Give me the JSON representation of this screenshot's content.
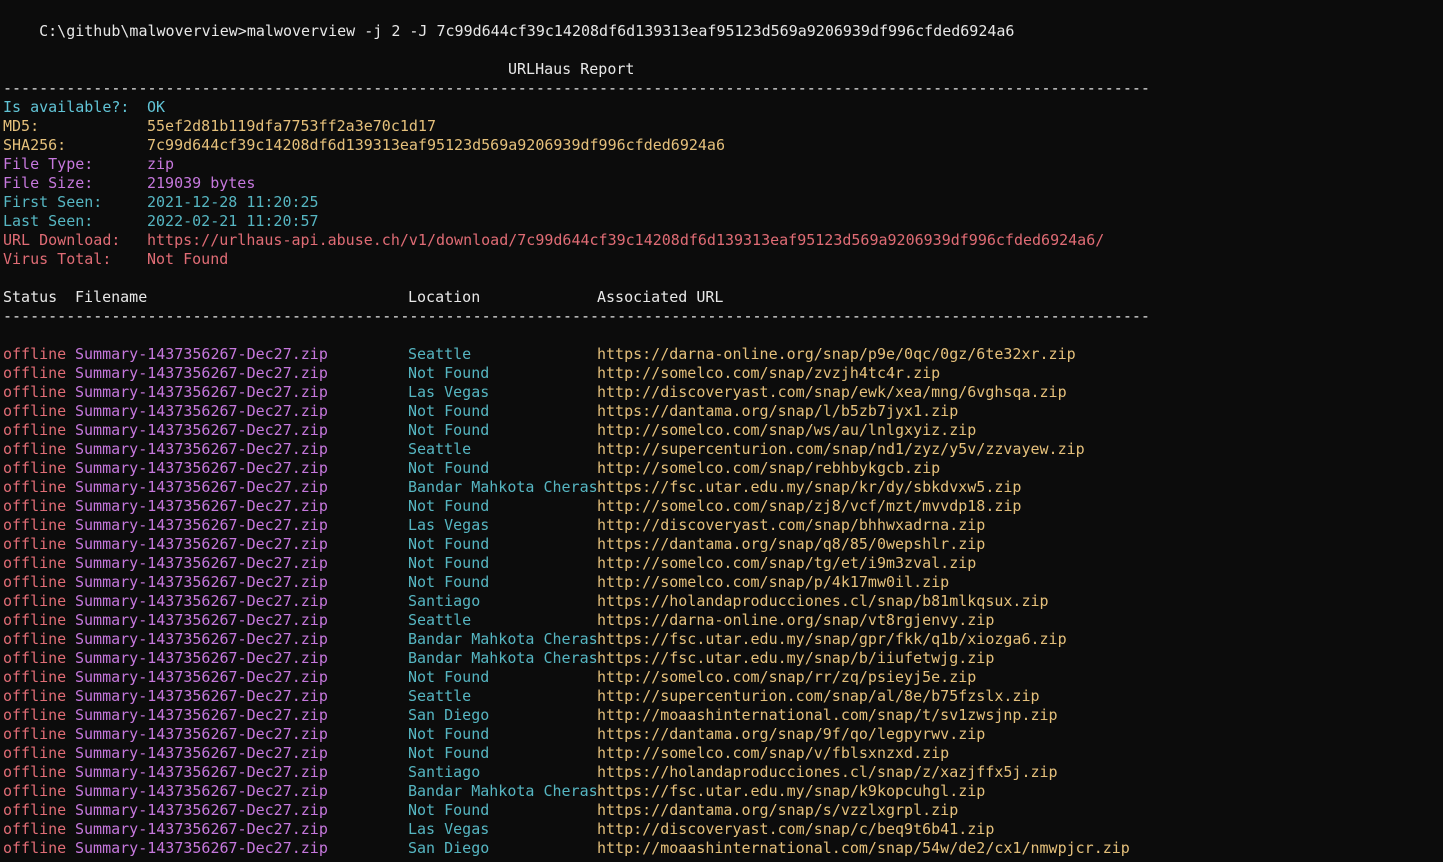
{
  "prompt": {
    "path": "C:\\github\\malwoverview>",
    "command": "malwoverview -j 2 -J 7c99d644cf39c14208df6d139313eaf95123d569a9206939df996cfded6924a6"
  },
  "report": {
    "title": "URLHaus Report",
    "separator": "-------------------------------------------------------------------------------------------------------------------------------",
    "fields": [
      {
        "label": "Is available?:",
        "value": "OK",
        "color": "#61c4d6"
      },
      {
        "label": "MD5:",
        "value": "55ef2d81b119dfa7753ff2a3e70c1d17",
        "color": "#e5c07b"
      },
      {
        "label": "SHA256:",
        "value": "7c99d644cf39c14208df6d139313eaf95123d569a9206939df996cfded6924a6",
        "color": "#e5c07b"
      },
      {
        "label": "File Type:",
        "value": "zip",
        "color": "#c678dd"
      },
      {
        "label": "File Size:",
        "value": "219039 bytes",
        "color": "#c678dd"
      },
      {
        "label": "First Seen:",
        "value": "2021-12-28 11:20:25",
        "color": "#56b6c2"
      },
      {
        "label": "Last Seen:",
        "value": "2022-02-21 11:20:57",
        "color": "#56b6c2"
      },
      {
        "label": "URL Download:",
        "value": "https://urlhaus-api.abuse.ch/v1/download/7c99d644cf39c14208df6d139313eaf95123d569a9206939df996cfded6924a6/",
        "color": "#e06c75"
      },
      {
        "label": "Virus Total:",
        "value": "Not Found",
        "color": "#e06c75"
      }
    ]
  },
  "table": {
    "headers": {
      "status": "Status",
      "filename": "Filename",
      "location": "Location",
      "url": "Associated URL"
    },
    "rows": [
      {
        "status": "offline",
        "filename": "Summary-1437356267-Dec27.zip",
        "location": "Seattle",
        "url": "https://darna-online.org/snap/p9e/0qc/0gz/6te32xr.zip"
      },
      {
        "status": "offline",
        "filename": "Summary-1437356267-Dec27.zip",
        "location": "Not Found",
        "url": "http://somelco.com/snap/zvzjh4tc4r.zip"
      },
      {
        "status": "offline",
        "filename": "Summary-1437356267-Dec27.zip",
        "location": "Las Vegas",
        "url": "http://discoveryast.com/snap/ewk/xea/mng/6vghsqa.zip"
      },
      {
        "status": "offline",
        "filename": "Summary-1437356267-Dec27.zip",
        "location": "Not Found",
        "url": "https://dantama.org/snap/l/b5zb7jyx1.zip"
      },
      {
        "status": "offline",
        "filename": "Summary-1437356267-Dec27.zip",
        "location": "Not Found",
        "url": "http://somelco.com/snap/ws/au/lnlgxyiz.zip"
      },
      {
        "status": "offline",
        "filename": "Summary-1437356267-Dec27.zip",
        "location": "Seattle",
        "url": "http://supercenturion.com/snap/nd1/zyz/y5v/zzvayew.zip"
      },
      {
        "status": "offline",
        "filename": "Summary-1437356267-Dec27.zip",
        "location": "Not Found",
        "url": "http://somelco.com/snap/rebhbykgcb.zip"
      },
      {
        "status": "offline",
        "filename": "Summary-1437356267-Dec27.zip",
        "location": "Bandar Mahkota Cheras",
        "url": "https://fsc.utar.edu.my/snap/kr/dy/sbkdvxw5.zip"
      },
      {
        "status": "offline",
        "filename": "Summary-1437356267-Dec27.zip",
        "location": "Not Found",
        "url": "http://somelco.com/snap/zj8/vcf/mzt/mvvdp18.zip"
      },
      {
        "status": "offline",
        "filename": "Summary-1437356267-Dec27.zip",
        "location": "Las Vegas",
        "url": "http://discoveryast.com/snap/bhhwxadrna.zip"
      },
      {
        "status": "offline",
        "filename": "Summary-1437356267-Dec27.zip",
        "location": "Not Found",
        "url": "https://dantama.org/snap/q8/85/0wepshlr.zip"
      },
      {
        "status": "offline",
        "filename": "Summary-1437356267-Dec27.zip",
        "location": "Not Found",
        "url": "http://somelco.com/snap/tg/et/i9m3zval.zip"
      },
      {
        "status": "offline",
        "filename": "Summary-1437356267-Dec27.zip",
        "location": "Not Found",
        "url": "http://somelco.com/snap/p/4k17mw0il.zip"
      },
      {
        "status": "offline",
        "filename": "Summary-1437356267-Dec27.zip",
        "location": "Santiago",
        "url": "https://holandaproducciones.cl/snap/b81mlkqsux.zip"
      },
      {
        "status": "offline",
        "filename": "Summary-1437356267-Dec27.zip",
        "location": "Seattle",
        "url": "https://darna-online.org/snap/vt8rgjenvy.zip"
      },
      {
        "status": "offline",
        "filename": "Summary-1437356267-Dec27.zip",
        "location": "Bandar Mahkota Cheras",
        "url": "https://fsc.utar.edu.my/snap/gpr/fkk/q1b/xiozga6.zip"
      },
      {
        "status": "offline",
        "filename": "Summary-1437356267-Dec27.zip",
        "location": "Bandar Mahkota Cheras",
        "url": "https://fsc.utar.edu.my/snap/b/iiufetwjg.zip"
      },
      {
        "status": "offline",
        "filename": "Summary-1437356267-Dec27.zip",
        "location": "Not Found",
        "url": "http://somelco.com/snap/rr/zq/psieyj5e.zip"
      },
      {
        "status": "offline",
        "filename": "Summary-1437356267-Dec27.zip",
        "location": "Seattle",
        "url": "http://supercenturion.com/snap/al/8e/b75fzslx.zip"
      },
      {
        "status": "offline",
        "filename": "Summary-1437356267-Dec27.zip",
        "location": "San Diego",
        "url": "http://moaashinternational.com/snap/t/sv1zwsjnp.zip"
      },
      {
        "status": "offline",
        "filename": "Summary-1437356267-Dec27.zip",
        "location": "Not Found",
        "url": "https://dantama.org/snap/9f/qo/legpyrwv.zip"
      },
      {
        "status": "offline",
        "filename": "Summary-1437356267-Dec27.zip",
        "location": "Not Found",
        "url": "http://somelco.com/snap/v/fblsxnzxd.zip"
      },
      {
        "status": "offline",
        "filename": "Summary-1437356267-Dec27.zip",
        "location": "Santiago",
        "url": "https://holandaproducciones.cl/snap/z/xazjffx5j.zip"
      },
      {
        "status": "offline",
        "filename": "Summary-1437356267-Dec27.zip",
        "location": "Bandar Mahkota Cheras",
        "url": "https://fsc.utar.edu.my/snap/k9kopcuhgl.zip"
      },
      {
        "status": "offline",
        "filename": "Summary-1437356267-Dec27.zip",
        "location": "Not Found",
        "url": "https://dantama.org/snap/s/vzzlxgrpl.zip"
      },
      {
        "status": "offline",
        "filename": "Summary-1437356267-Dec27.zip",
        "location": "Las Vegas",
        "url": "http://discoveryast.com/snap/c/beq9t6b41.zip"
      },
      {
        "status": "offline",
        "filename": "Summary-1437356267-Dec27.zip",
        "location": "San Diego",
        "url": "http://moaashinternational.com/snap/54w/de2/cx1/nmwpjcr.zip"
      }
    ]
  },
  "colors": {
    "background": "#0c0c0c",
    "status_offline": "#e06c75",
    "filename": "#c678dd",
    "location": "#56b6c2",
    "url": "#e5c07b"
  }
}
